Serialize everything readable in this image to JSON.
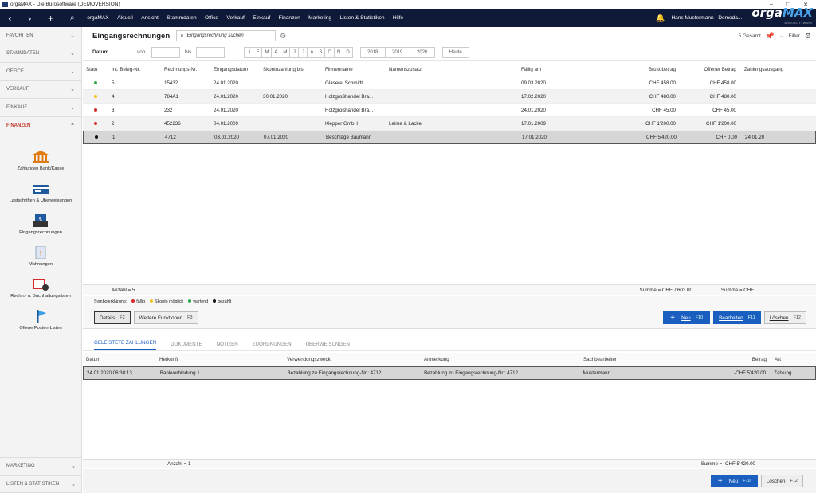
{
  "window": {
    "title": "orgaMAX - Die Bürosoftware (DEMOVERSION)"
  },
  "menu": {
    "items": [
      "orgaMAX",
      "Aktuell",
      "Ansicht",
      "Stammdaten",
      "Office",
      "Verkauf",
      "Einkauf",
      "Finanzen",
      "Marketing",
      "Listen & Statistiken",
      "Hilfe"
    ],
    "user": "Hans Mustermann - Demoda...",
    "logo_a": "orga",
    "logo_b": "MAX",
    "logo_sub": "BÜROSOFTWARE"
  },
  "sidebar": {
    "groups": [
      "FAVORITEN",
      "STAMMDATEN",
      "OFFICE",
      "VERKAUF",
      "EINKAUF"
    ],
    "open_group": "FINANZEN",
    "items": [
      "Zahlungen Bank/Kasse",
      "Lastschriften & Überweisungen",
      "Eingangsrechnungen",
      "Mahnungen",
      "Rechn.- u. Buchhaltungslisten",
      "Offene Posten-Listen"
    ],
    "bottom": [
      "MARKETING",
      "LISTEN & STATISTIKEN"
    ]
  },
  "header": {
    "title": "Eingangsrechnungen",
    "search_placeholder": "Eingangsrechnung suchen",
    "total": "5 Gesamt",
    "filter": "Filter"
  },
  "filter": {
    "datum": "Datum",
    "von": "von",
    "bis": "bis",
    "months": [
      "J",
      "F",
      "M",
      "A",
      "M",
      "J",
      "J",
      "A",
      "S",
      "O",
      "N",
      "D"
    ],
    "years": [
      "2018",
      "2019",
      "2020"
    ],
    "today": "Heute"
  },
  "grid": {
    "columns": [
      "Statu",
      "Int. Beleg-Nr.",
      "Rechnungs-Nr.",
      "Eingangsdatum",
      "Skontozahlung bis",
      "Firmenname",
      "Namenszusatz",
      "Fällig am",
      "Bruttobetrag",
      "Offener Betrag",
      "Zahlungsausgang"
    ],
    "rows": [
      {
        "status": "#2eaa4a",
        "beleg": "5",
        "rnr": "15432",
        "eingang": "24.01.2020",
        "skonto": "",
        "firma": "Glaserei Schmidt",
        "zusatz": "",
        "faellig": "09.03.2020",
        "brutto": "CHF 458.00",
        "offen": "CHF 458.00",
        "ausgang": ""
      },
      {
        "status": "#f0c419",
        "beleg": "4",
        "rnr": "784A1",
        "eingang": "24.01.2020",
        "skonto": "30.01.2020",
        "firma": "Holzgroßhandel Bra...",
        "zusatz": "",
        "faellig": "17.02.2020",
        "brutto": "CHF 480.00",
        "offen": "CHF 480.00",
        "ausgang": ""
      },
      {
        "status": "#d62c2c",
        "beleg": "3",
        "rnr": "232",
        "eingang": "24.01.2020",
        "skonto": "",
        "firma": "Holzgroßhandel Bra...",
        "zusatz": "",
        "faellig": "24.01.2020",
        "brutto": "CHF 45.00",
        "offen": "CHF 45.00",
        "ausgang": ""
      },
      {
        "status": "#d62c2c",
        "beleg": "2",
        "rnr": "452236",
        "eingang": "04.01.2009",
        "skonto": "",
        "firma": "Klepper GmbH",
        "zusatz": "Leime & Lacke",
        "faellig": "17.01.2009",
        "brutto": "CHF 1'200.00",
        "offen": "CHF 1'200.00",
        "ausgang": ""
      },
      {
        "status": "#111111",
        "beleg": "1",
        "rnr": "4712",
        "eingang": "03.01.2020",
        "skonto": "07.01.2020",
        "firma": "Beschläge Baumann",
        "zusatz": "",
        "faellig": "17.01.2020",
        "brutto": "CHF 5'420.00",
        "offen": "CHF 0.00",
        "ausgang": "24.01.20"
      }
    ],
    "count": "Anzahl = 5",
    "sum1": "Summe = CHF 7'603.00",
    "sum2": "Summe = CHF"
  },
  "legend": {
    "label": "Symbolerklärung:",
    "items": [
      {
        "c": "#d62c2c",
        "t": "fällig"
      },
      {
        "c": "#f0c419",
        "t": "Skonto möglich"
      },
      {
        "c": "#2eaa4a",
        "t": "wartend"
      },
      {
        "c": "#111111",
        "t": "bezahlt"
      }
    ]
  },
  "actions": {
    "details": "Details",
    "details_k": "F2",
    "weitere": "Weitere Funktionen",
    "weitere_k": "F3",
    "neu": "Neu",
    "neu_k": "F10",
    "bearbeiten": "Bearbeiten",
    "bearbeiten_k": "F11",
    "loeschen": "Löschen",
    "loeschen_k": "F12"
  },
  "tabs": [
    "GELEISTETE ZAHLUNGEN",
    "DOKUMENTE",
    "NOTIZEN",
    "ZUORDNUNGEN",
    "ÜBERWEISUNGEN"
  ],
  "payments": {
    "columns": [
      "Datum",
      "Herkunft",
      "Verwendungszweck",
      "Anmerkung",
      "Sachbearbeiter",
      "Betrag",
      "Art"
    ],
    "rows": [
      {
        "datum": "24.01.2020 06:38:13",
        "herkunft": "Bankverbindung 1",
        "zweck": "Bezahlung zu Eingangsrechnung-Nr.: 4712",
        "anmerkung": "Bezahlung zu Eingangsrechnung-Nr.: 4712",
        "bearbeiter": "Mustermann",
        "betrag": "-CHF 5'420.00",
        "art": "Zahlung"
      }
    ],
    "count": "Anzahl = 1",
    "sum": "Summe = -CHF 5'420.00"
  }
}
